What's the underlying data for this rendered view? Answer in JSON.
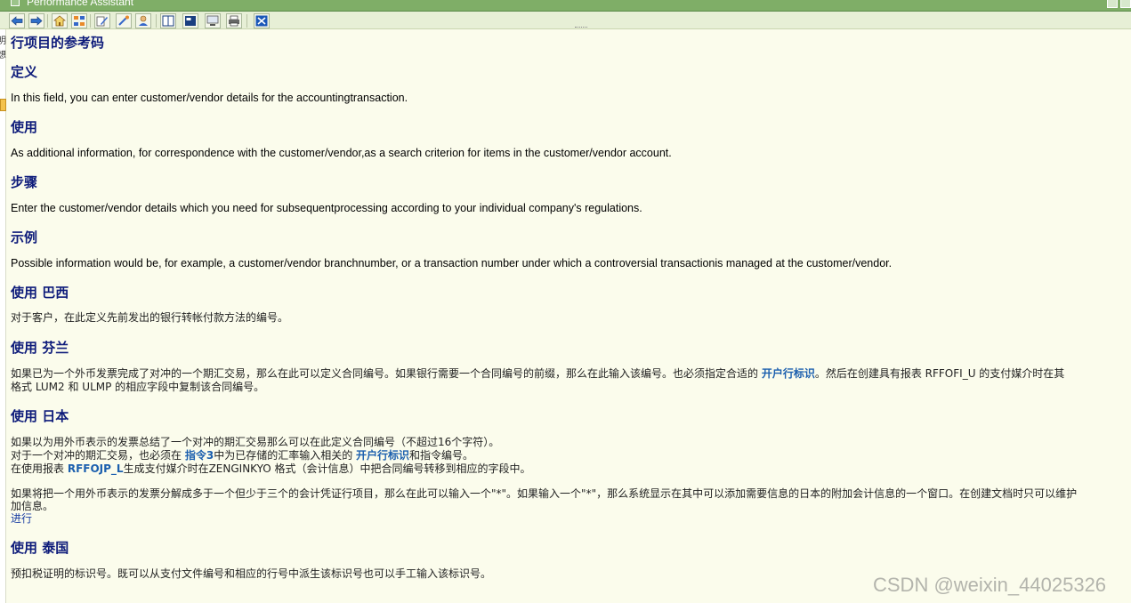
{
  "window": {
    "title": "Performance Assistant"
  },
  "toolbar": {
    "buttons": [
      {
        "icon": "back-arrow-icon"
      },
      {
        "icon": "forward-arrow-icon"
      },
      {
        "icon": "home-icon"
      },
      {
        "icon": "structure-icon"
      },
      {
        "icon": "edit-icon"
      },
      {
        "icon": "technical-info-icon"
      },
      {
        "icon": "user-icon"
      },
      {
        "icon": "book-icon"
      },
      {
        "icon": "display-icon"
      },
      {
        "icon": "window-icon"
      },
      {
        "icon": "print-icon"
      },
      {
        "icon": "close-icon"
      }
    ]
  },
  "left_edge": {
    "chars": [
      "明",
      "想"
    ]
  },
  "doc": {
    "title": "行项目的参考码",
    "definition": {
      "heading": "定义",
      "text": "In this field, you can enter customer/vendor details for the accountingtransaction."
    },
    "use": {
      "heading": "使用",
      "text": "As additional information, for correspondence with the customer/vendor,as a search criterion for items in the customer/vendor account."
    },
    "procedure": {
      "heading": "步骤",
      "text": "Enter the customer/vendor details which you need for subsequentprocessing according to your individual company's regulations."
    },
    "example": {
      "heading": "示例",
      "text": "Possible information would be, for example, a customer/vendor branchnumber, or a transaction number under which a controversial transactionis managed at the customer/vendor."
    },
    "brazil": {
      "heading": "使用 巴西",
      "text": "对于客户，在此定义先前发出的银行转帐付款方法的编号。"
    },
    "finland": {
      "heading": "使用 芬兰",
      "line1_a": "如果已为一个外币发票完成了对冲的一个期汇交易，那么在此可以定义合同编号。如果银行需要一个合同编号的前缀，那么在此输入该编号。也必须指定合适的 ",
      "line1_link": "开户行标识",
      "line1_b": "。然后在创建具有报表 RFFOFI_U 的支付媒介时在其",
      "line2": "格式 LUM2 和 ULMP 的相应字段中复制该合同编号。"
    },
    "japan": {
      "heading": "使用 日本",
      "line1": "如果以为用外币表示的发票总结了一个对冲的期汇交易那么可以在此定义合同编号（不超过16个字符）。",
      "line2_a": "对于一个对冲的期汇交易，也必须在 ",
      "line2_link1": "指令3",
      "line2_b": "中为已存储的汇率输入相关的 ",
      "line2_link2": "开户行标识",
      "line2_c": "和指令编号。",
      "line3_a": "在使用报表 ",
      "line3_link": "RFFOJP_L",
      "line3_b": "生成支付媒介时在ZENGINKYO 格式（会计信息）中把合同编号转移到相应的字段中。",
      "line4": "如果将把一个用外币表示的发票分解成多于一个但少于三个的会计凭证行项目，那么在此可以输入一个\"*\"。如果输入一个\"*\"，那么系统显示在其中可以添加需要信息的日本的附加会计信息的一个窗口。在创建文档时只可以维护",
      "line5": "加信息。",
      "line6_link": "进行"
    },
    "thailand": {
      "heading": "使用 泰国",
      "text": "预扣税证明的标识号。既可以从支付文件编号和相应的行号中派生该标识号也可以手工输入该标识号。"
    }
  },
  "watermark": "CSDN @weixin_44025326"
}
